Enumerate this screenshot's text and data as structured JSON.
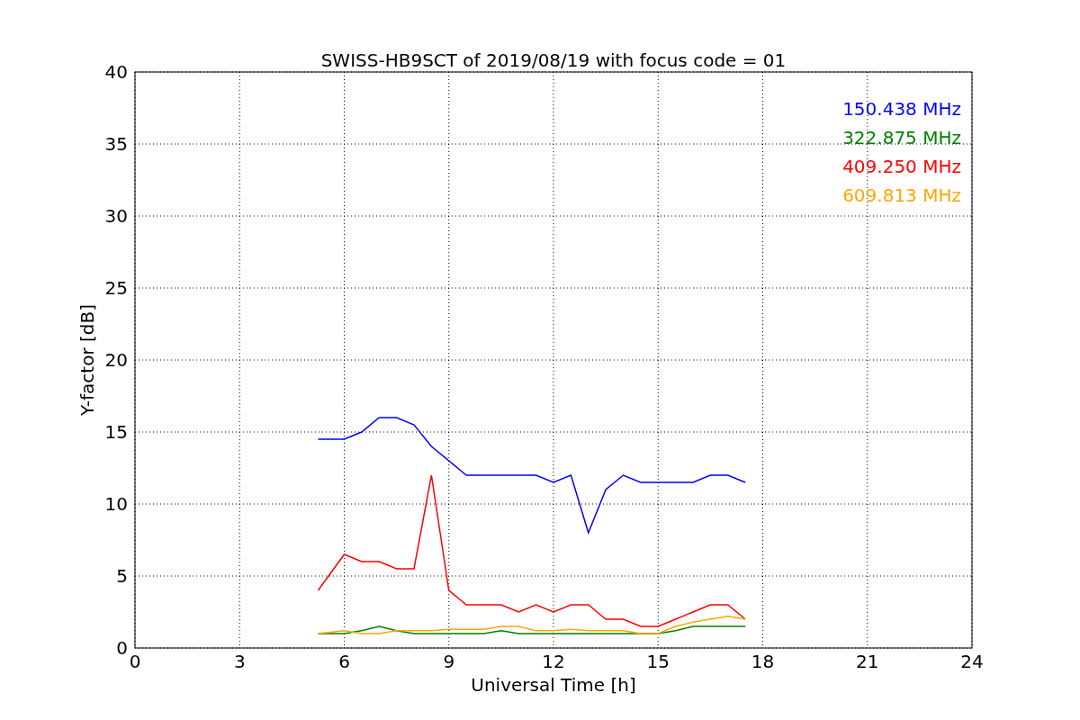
{
  "chart_data": {
    "type": "line",
    "title": "SWISS-HB9SCT of 2019/08/19 with focus code = 01",
    "xlabel": "Universal Time [h]",
    "ylabel": "Y-factor [dB]",
    "x": [
      5.25,
      6,
      6.5,
      7,
      7.5,
      8,
      8.5,
      9,
      9.5,
      10,
      10.5,
      11,
      11.5,
      12,
      12.5,
      13,
      13.5,
      14,
      14.5,
      15,
      15.5,
      16,
      16.5,
      17,
      17.5
    ],
    "series": [
      {
        "name": "150.438 MHz",
        "color": "#0000ff",
        "values": [
          14.5,
          14.5,
          15,
          16,
          16,
          15.5,
          14,
          13,
          12,
          12,
          12,
          12,
          12,
          11.5,
          12,
          8,
          11,
          12,
          11.5,
          11.5,
          11.5,
          11.5,
          12,
          12,
          11.5
        ]
      },
      {
        "name": "322.875 MHz",
        "color": "#008000",
        "values": [
          1,
          1,
          1.2,
          1.5,
          1.2,
          1,
          1,
          1,
          1,
          1,
          1.2,
          1,
          1,
          1,
          1,
          1,
          1,
          1,
          1,
          1,
          1.2,
          1.5,
          1.5,
          1.5,
          1.5
        ]
      },
      {
        "name": "409.250 MHz",
        "color": "#ff0000",
        "values": [
          4,
          6.5,
          6,
          6,
          5.5,
          5.5,
          12,
          4,
          3,
          3,
          3,
          2.5,
          3,
          2.5,
          3,
          3,
          2,
          2,
          1.5,
          1.5,
          2,
          2.5,
          3,
          3,
          2
        ]
      },
      {
        "name": "609.813 MHz",
        "color": "#ffa500",
        "values": [
          1,
          1.2,
          1,
          1,
          1.2,
          1.2,
          1.2,
          1.3,
          1.3,
          1.3,
          1.5,
          1.5,
          1.2,
          1.2,
          1.3,
          1.2,
          1.2,
          1.2,
          1,
          1,
          1.5,
          1.8,
          2,
          2.2,
          2
        ]
      }
    ],
    "grid": true,
    "xlim": [
      0,
      24
    ],
    "ylim": [
      0,
      40
    ],
    "xticks": [
      0,
      3,
      6,
      9,
      12,
      15,
      18,
      21,
      24
    ],
    "yticks": [
      0,
      5,
      10,
      15,
      20,
      25,
      30,
      35,
      40
    ]
  }
}
